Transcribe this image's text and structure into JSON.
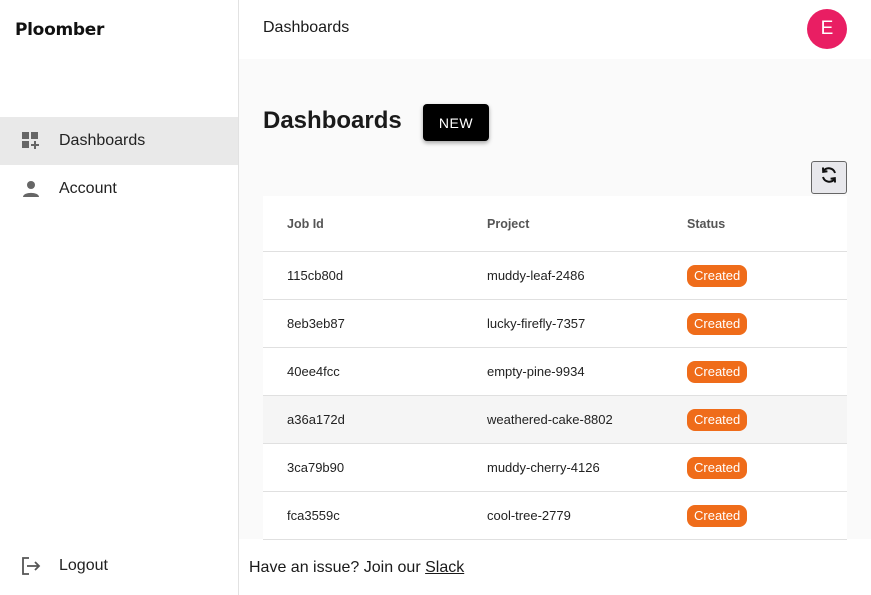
{
  "brand": {
    "name": "Ploomber"
  },
  "sidebar": {
    "items": [
      {
        "label": "Dashboards",
        "icon": "dashboard-add-icon",
        "active": true
      },
      {
        "label": "Account",
        "icon": "person-icon",
        "active": false
      }
    ],
    "logout_label": "Logout"
  },
  "header": {
    "title": "Dashboards",
    "avatar_initial": "E",
    "avatar_color": "#e91e63"
  },
  "main": {
    "heading": "Dashboards",
    "new_button_label": "NEW",
    "table": {
      "columns": [
        "Job Id",
        "Project",
        "Status"
      ],
      "rows": [
        {
          "job_id": "115cb80d",
          "project": "muddy-leaf-2486",
          "status": "Created"
        },
        {
          "job_id": "8eb3eb87",
          "project": "lucky-firefly-7357",
          "status": "Created"
        },
        {
          "job_id": "40ee4fcc",
          "project": "empty-pine-9934",
          "status": "Created"
        },
        {
          "job_id": "a36a172d",
          "project": "weathered-cake-8802",
          "status": "Created"
        },
        {
          "job_id": "3ca79b90",
          "project": "muddy-cherry-4126",
          "status": "Created"
        },
        {
          "job_id": "fca3559c",
          "project": "cool-tree-2779",
          "status": "Created"
        }
      ]
    }
  },
  "footer": {
    "text": "Have an issue? Join our ",
    "link_label": "Slack"
  },
  "colors": {
    "status_chip": "#ef6c1a",
    "primary_button": "#000000"
  }
}
